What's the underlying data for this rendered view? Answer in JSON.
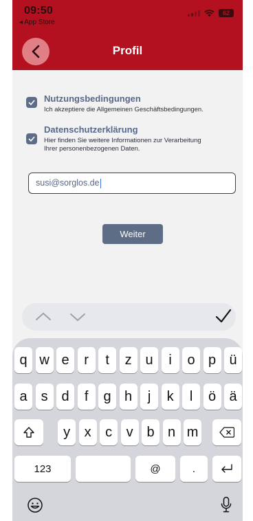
{
  "status_bar": {
    "time": "09:50",
    "back_app": "◂ App Store",
    "battery": "62"
  },
  "header": {
    "title": "Profil"
  },
  "terms": {
    "title": "Nutzungsbedingungen",
    "description": "Ich akzeptiere die Allgemeinen Geschäftsbedingungen.",
    "checked": true
  },
  "privacy": {
    "title": "Datenschutzerklärung",
    "description_line1": "Hier finden Sie weitere Informationen zur Verarbeitung",
    "description_line2": "Ihrer personenbezogenen Daten.",
    "checked": true
  },
  "email": {
    "value": "susi@sorglos.de"
  },
  "next_button": {
    "label": "Weiter"
  },
  "keyboard": {
    "row1": [
      "q",
      "w",
      "e",
      "r",
      "t",
      "z",
      "u",
      "i",
      "o",
      "p",
      "ü"
    ],
    "row2": [
      "a",
      "s",
      "d",
      "f",
      "g",
      "h",
      "j",
      "k",
      "l",
      "ö",
      "ä"
    ],
    "row3": [
      "y",
      "x",
      "c",
      "v",
      "b",
      "n",
      "m"
    ],
    "row4": {
      "numbers": "123",
      "at": "@",
      "dot": "."
    }
  },
  "colors": {
    "brand_red": "#b3111f",
    "accent_slate": "#5e6d86"
  },
  "icons": [
    "chevron-left-icon",
    "chevron-up-icon",
    "chevron-down-icon",
    "checkmark-icon",
    "shift-icon",
    "backspace-icon",
    "return-icon",
    "emoji-icon",
    "microphone-icon",
    "signal-icon",
    "wifi-icon",
    "battery-icon"
  ]
}
